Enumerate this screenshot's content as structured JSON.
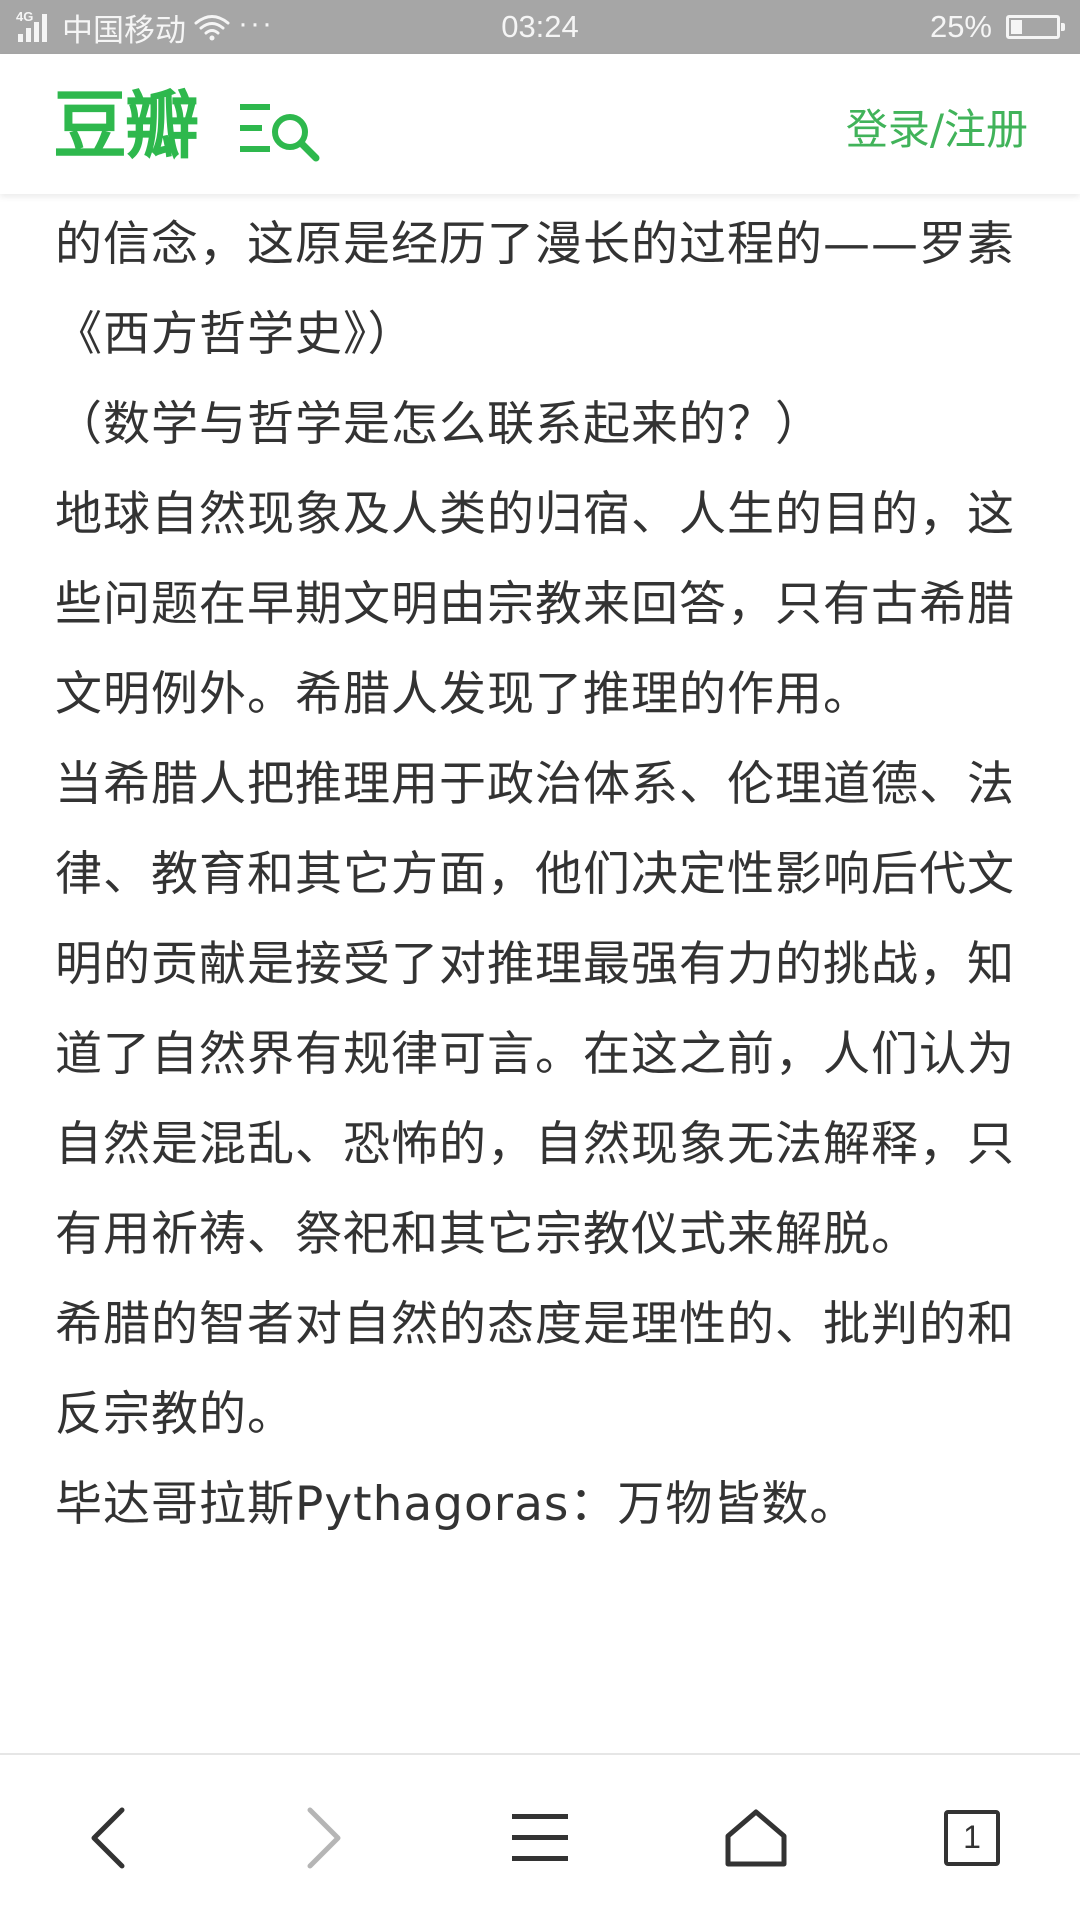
{
  "status_bar": {
    "network_type": "4G",
    "carrier": "中国移动",
    "dots": "···",
    "time": "03:24",
    "battery_percent": "25%",
    "battery_level": 0.25
  },
  "header": {
    "logo": "豆瓣",
    "auth_label": "登录/注册",
    "accent_color": "#2eb84d"
  },
  "content": {
    "paragraphs": [
      "的信念，这原是经历了漫长的过程的——罗素《西方哲学史》）",
      "（数学与哲学是怎么联系起来的？）",
      "地球自然现象及人类的归宿、人生的目的，这些问题在早期文明由宗教来回答，只有古希腊文明例外。希腊人发现了推理的作用。",
      "当希腊人把推理用于政治体系、伦理道德、法律、教育和其它方面，他们决定性影响后代文明的贡献是接受了对推理最强有力的挑战，知道了自然界有规律可言。在这之前，人们认为自然是混乱、恐怖的，自然现象无法解释，只有用祈祷、祭祀和其它宗教仪式来解脱。",
      "希腊的智者对自然的态度是理性的、批判的和反宗教的。",
      "毕达哥拉斯Pythagoras：万物皆数。"
    ]
  },
  "bottom_nav": {
    "tab_count": "1",
    "icons": [
      "back-icon",
      "forward-icon",
      "menu-icon",
      "home-icon",
      "tabs-icon"
    ]
  }
}
